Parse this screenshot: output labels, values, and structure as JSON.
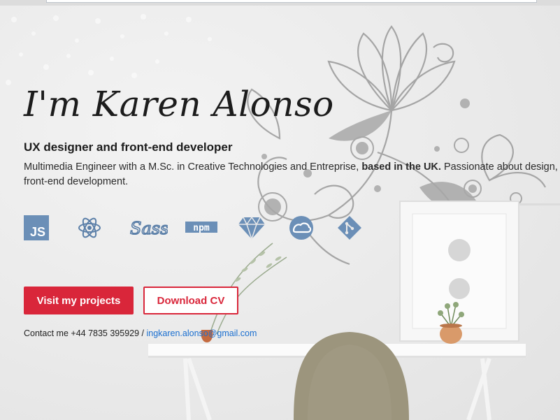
{
  "hero": {
    "title": "I'm Karen Alonso",
    "subtitle": "UX designer and front-end developer",
    "description_prefix": "Multimedia Engineer with a M.Sc. in Creative Technologies and Entreprise, ",
    "description_bold": "based in the UK.",
    "description_suffix": " Passionate about design, front-end development."
  },
  "skills": [
    {
      "icon": "javascript-icon",
      "label": "JS"
    },
    {
      "icon": "react-icon",
      "label": ""
    },
    {
      "icon": "sass-icon",
      "label": "Sass"
    },
    {
      "icon": "npm-icon",
      "label": "npm"
    },
    {
      "icon": "sketch-icon",
      "label": ""
    },
    {
      "icon": "creative-cloud-icon",
      "label": ""
    },
    {
      "icon": "git-icon",
      "label": ""
    }
  ],
  "buttons": {
    "projects": "Visit my projects",
    "cv": "Download CV"
  },
  "contact": {
    "prefix": "Contact me +44 7835 395929 / ",
    "email": "ingkaren.alonso@gmail.com"
  },
  "colors": {
    "accent": "#d9263a",
    "icon": "#5b7fa8",
    "link": "#1a6fd0"
  }
}
